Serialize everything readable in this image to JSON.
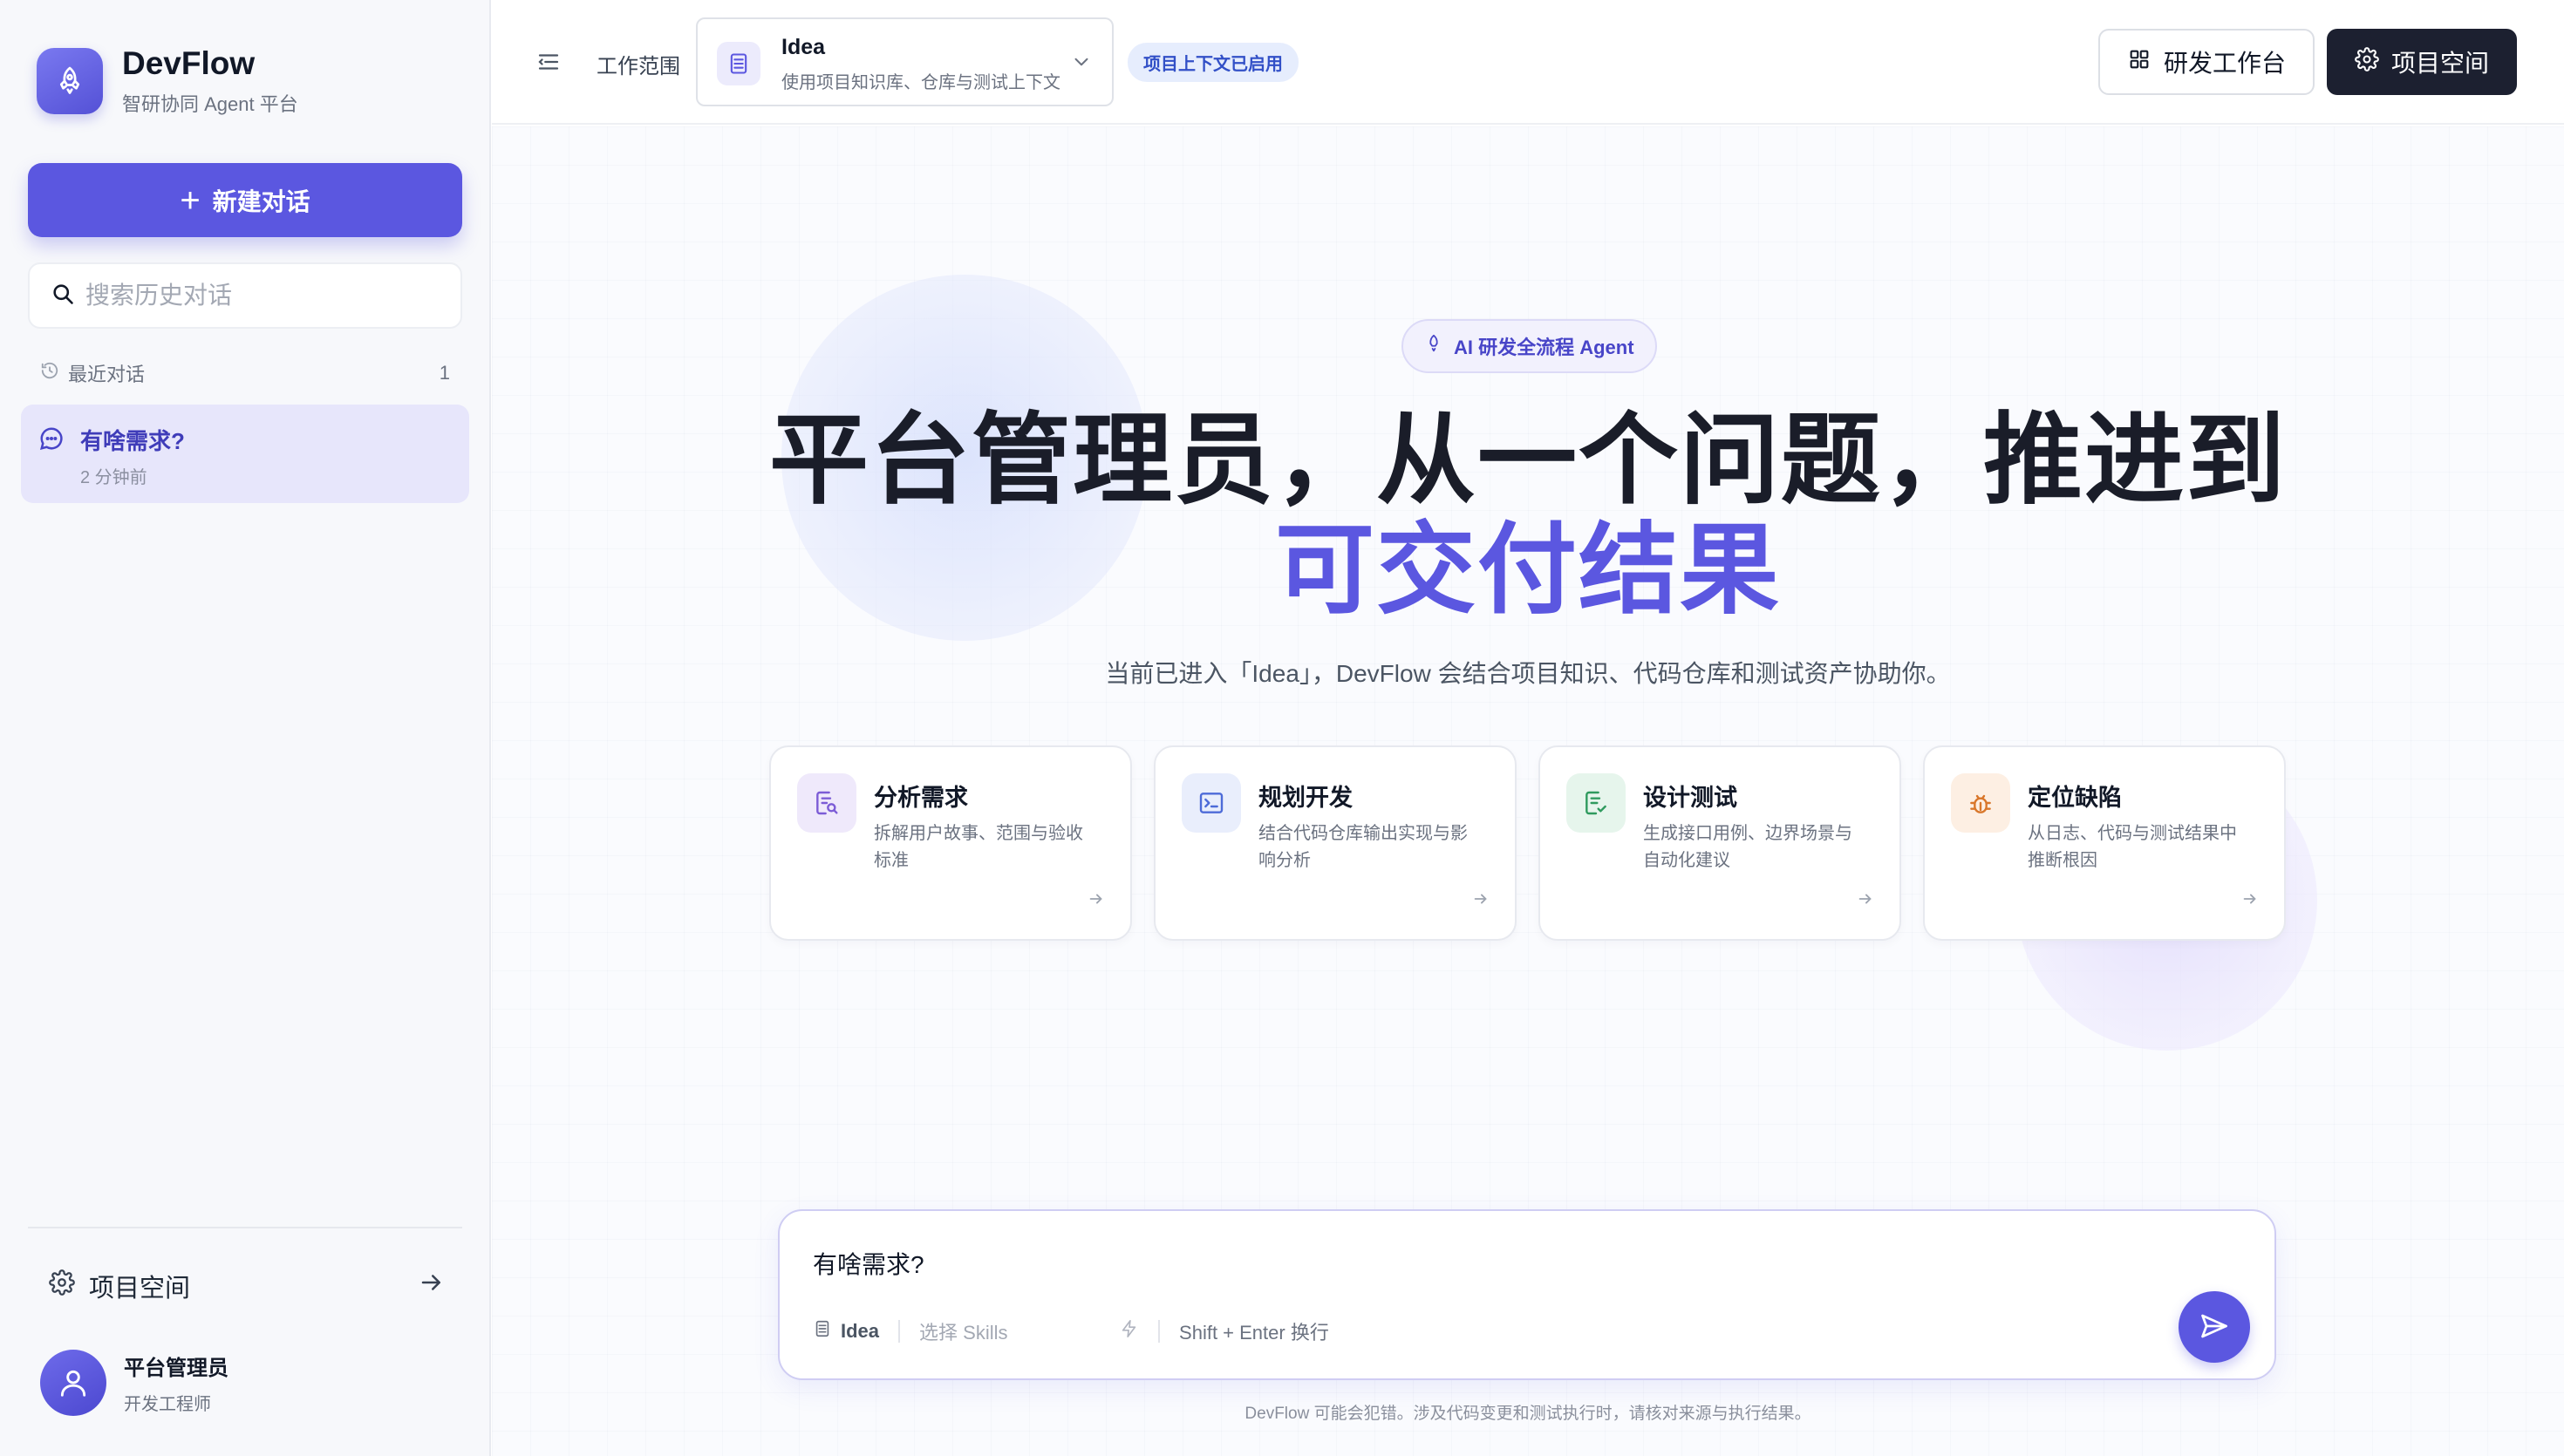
{
  "sidebar": {
    "brand_name": "DevFlow",
    "brand_subtitle": "智研协同 Agent 平台",
    "new_chat_label": "新建对话",
    "search_placeholder": "搜索历史对话",
    "recent_label": "最近对话",
    "recent_count": "1",
    "conversations": [
      {
        "title": "有啥需求?",
        "time": "2 分钟前"
      }
    ],
    "project_space_label": "项目空间",
    "user": {
      "name": "平台管理员",
      "role": "开发工程师"
    }
  },
  "header": {
    "scope_label": "工作范围",
    "scope": {
      "name": "Idea",
      "description": "使用项目知识库、仓库与测试上下文"
    },
    "context_badge": "项目上下文已启用",
    "workbench_label": "研发工作台",
    "project_space_label": "项目空间"
  },
  "hero": {
    "pill": "AI 研发全流程 Agent",
    "title": "平台管理员，从一个问题，推进到",
    "title_accent": "可交付结果",
    "subtitle": "当前已进入「Idea」，DevFlow 会结合项目知识、代码仓库和测试资产协助你。"
  },
  "cards": [
    {
      "title": "分析需求",
      "desc": "拆解用户故事、范围与验收标准",
      "icon": "document-search-icon",
      "color": "#7c5cd6"
    },
    {
      "title": "规划开发",
      "desc": "结合代码仓库输出实现与影响分析",
      "icon": "terminal-icon",
      "color": "#4d6bd8"
    },
    {
      "title": "设计测试",
      "desc": "生成接口用例、边界场景与自动化建议",
      "icon": "test-document-icon",
      "color": "#2f9a5e"
    },
    {
      "title": "定位缺陷",
      "desc": "从日志、代码与测试结果中推断根因",
      "icon": "bug-icon",
      "color": "#d9772b"
    }
  ],
  "composer": {
    "text": "有啥需求?",
    "scope_name": "Idea",
    "skills_placeholder": "选择 Skills",
    "hint": "Shift + Enter 换行"
  },
  "disclaimer": "DevFlow 可能会犯错。涉及代码变更和测试执行时，请核对来源与执行结果。",
  "colors": {
    "accent": "#5b57e0",
    "dark_button": "#1c2030",
    "badge_bg": "#e6edfd"
  }
}
